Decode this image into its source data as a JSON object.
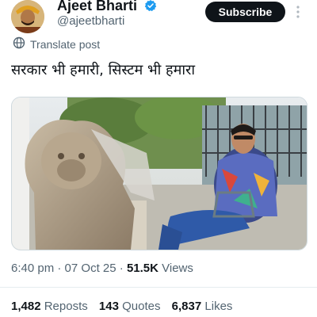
{
  "header": {
    "display_name": "Ajeet Bharti",
    "handle": "@ajeetbharti",
    "subscribe_label": "Subscribe",
    "verified_icon": "verified-badge-icon",
    "more_icon": "more-vertical-icon"
  },
  "translate": {
    "label": "Translate post",
    "icon": "translate-icon"
  },
  "tweet": {
    "text": "सरकार भी हमारी, सिस्टम भी हमारा"
  },
  "meta": {
    "time": "6:40 pm",
    "separator": " · ",
    "date": "07 Oct 25",
    "views_count": "51.5K",
    "views_label": "Views"
  },
  "stats": {
    "reposts_count": "1,482",
    "reposts_label": "Reposts",
    "quotes_count": "143",
    "quotes_label": "Quotes",
    "likes_count": "6,837",
    "likes_label": "Likes"
  },
  "colors": {
    "text_primary": "#0f1419",
    "text_secondary": "#536471",
    "verified_blue": "#1d9bf0",
    "subscribe_bg": "#0f1419"
  }
}
